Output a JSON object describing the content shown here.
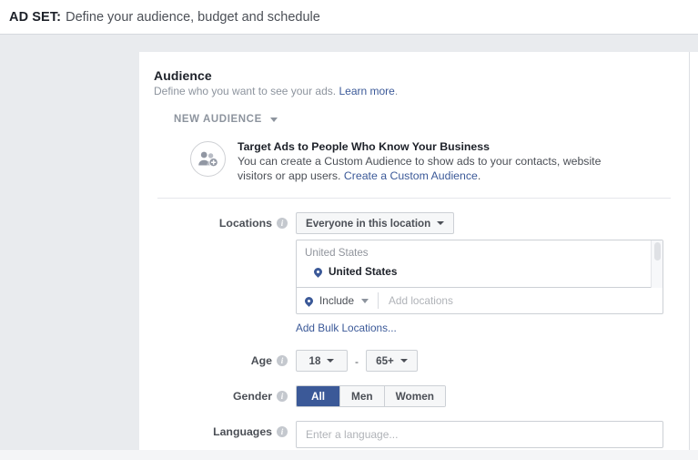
{
  "header": {
    "prefix": "AD SET:",
    "title": "Define your audience, budget and schedule"
  },
  "audience": {
    "section_title": "Audience",
    "section_subtitle": "Define who you want to see your ads.",
    "learn_more": "Learn more",
    "subtitle_period": ".",
    "saved_audience_label": "NEW AUDIENCE",
    "promo": {
      "icon": "add-users-icon",
      "title": "Target Ads to People Who Know Your Business",
      "body": "You can create a Custom Audience to show ads to your contacts, website visitors or app users.",
      "link": "Create a Custom Audience",
      "link_period": "."
    },
    "locations": {
      "label": "Locations",
      "info_icon": "info-icon",
      "scope_dropdown": "Everyone in this location",
      "group_header": "United States",
      "selected": [
        {
          "name": "United States",
          "icon": "map-pin-icon"
        }
      ],
      "include_dropdown": "Include",
      "add_placeholder": "Add locations",
      "bulk_link": "Add Bulk Locations..."
    },
    "age": {
      "label": "Age",
      "info_icon": "info-icon",
      "min": "18",
      "separator": "-",
      "max": "65+"
    },
    "gender": {
      "label": "Gender",
      "info_icon": "info-icon",
      "options": [
        "All",
        "Men",
        "Women"
      ],
      "selected": "All"
    },
    "languages": {
      "label": "Languages",
      "info_icon": "info-icon",
      "placeholder": "Enter a language...",
      "value": ""
    }
  },
  "colors": {
    "brand_blue": "#3b5998",
    "page_gray": "#e9ebee",
    "text_dark": "#1d2129",
    "text_muted": "#8d949e"
  }
}
